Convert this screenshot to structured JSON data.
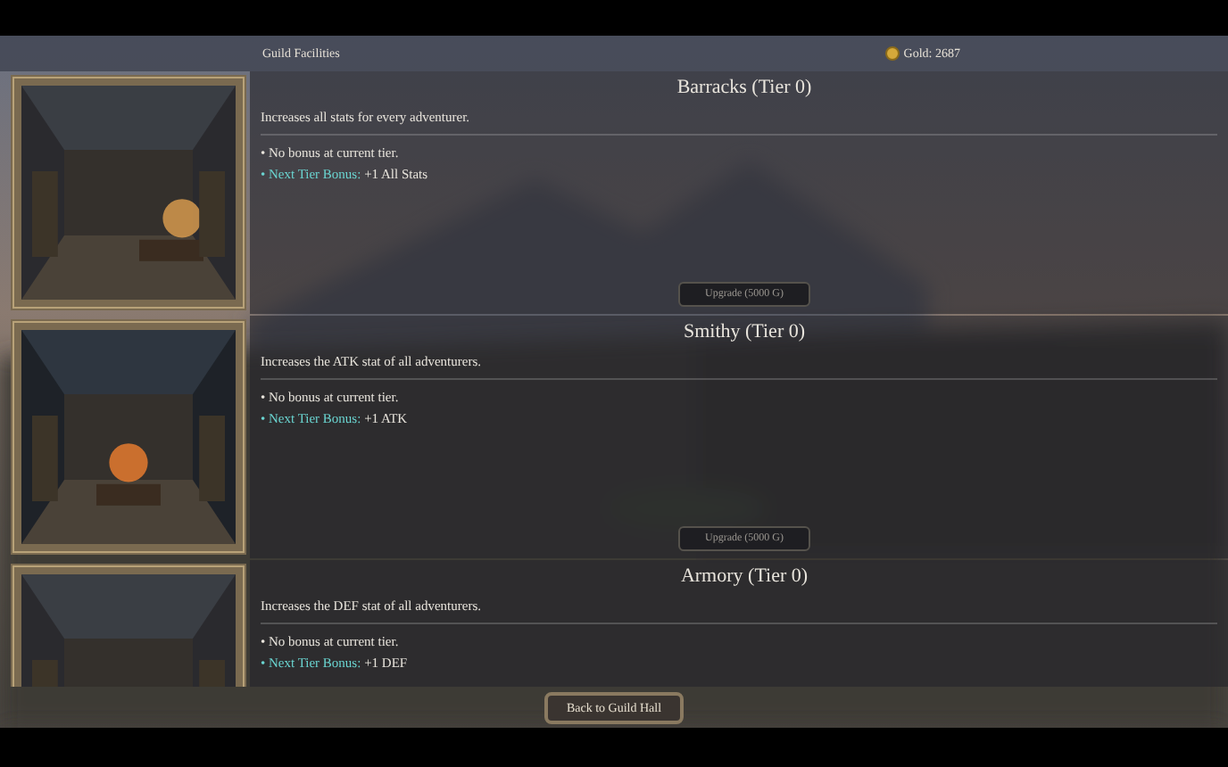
{
  "header": {
    "title": "Guild Facilities",
    "gold": "Gold: 2687"
  },
  "facilities": [
    {
      "title": "Barracks (Tier 0)",
      "description": "Increases all stats for every adventurer.",
      "current": "• No bonus at current tier.",
      "next_label": "• Next Tier Bonus:",
      "next_value": "+1 All Stats",
      "upgrade": "Upgrade (5000 G)"
    },
    {
      "title": "Smithy (Tier 0)",
      "description": "Increases the ATK stat of all adventurers.",
      "current": "• No bonus at current tier.",
      "next_label": "• Next Tier Bonus:",
      "next_value": "+1 ATK",
      "upgrade": "Upgrade (5000 G)"
    },
    {
      "title": "Armory (Tier 0)",
      "description": "Increases the DEF stat of all adventurers.",
      "current": "• No bonus at current tier.",
      "next_label": "• Next Tier Bonus:",
      "next_value": "+1 DEF"
    }
  ],
  "back_button": "Back to Guild Hall"
}
